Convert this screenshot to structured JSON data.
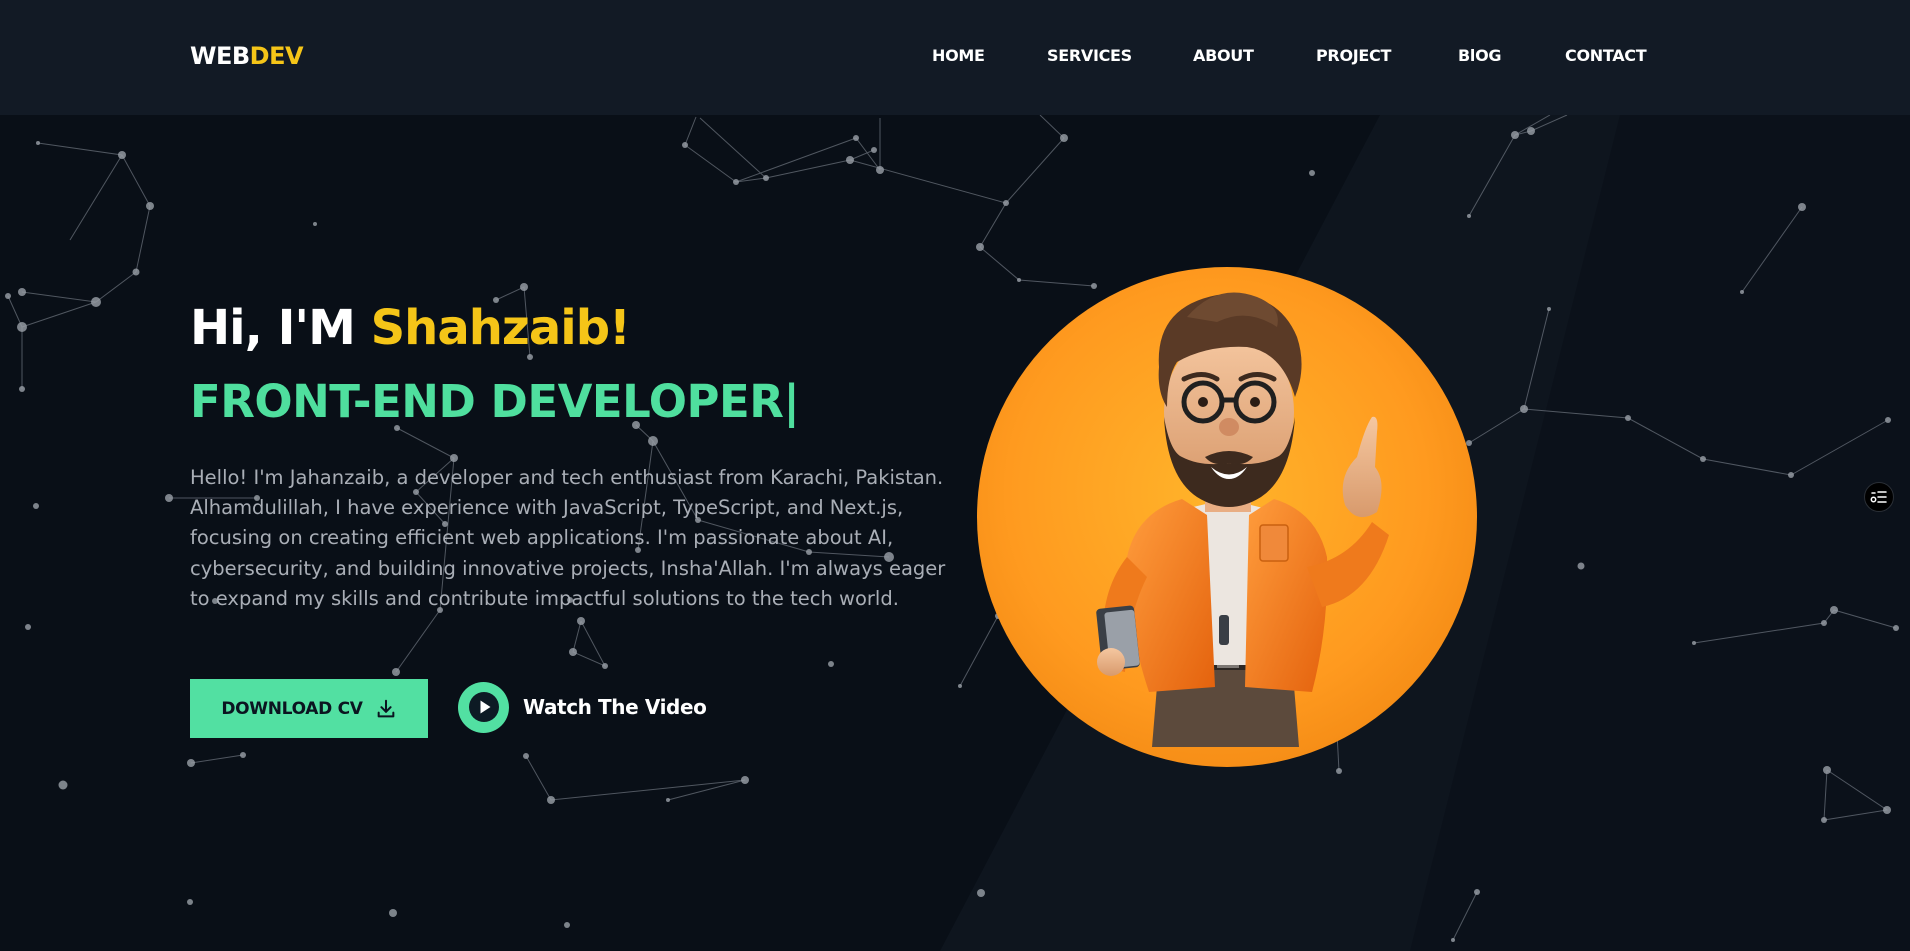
{
  "header": {
    "logo_part1": "WEB",
    "logo_part2": "DEV",
    "nav": [
      "HOME",
      "SERVICES",
      "ABOUT",
      "PROJECT",
      "BlOG",
      "CONTACT"
    ]
  },
  "hero": {
    "greeting": "Hi, I'M",
    "name": "Shahzaib!",
    "role": "FRONT-END DEVELOPER|",
    "description": "Hello! I'm Jahanzaib, a developer and tech enthusiast from Karachi, Pakistan. Alhamdulillah, I have experience with JavaScript, TypeScript, and Next.js, focusing on creating efficient web applications. I'm passionate about AI, cybersecurity, and building innovative projects, Insha'Allah. I'm always eager to expand my skills and contribute impactful solutions to the tech world.",
    "download_cv_label": "DOWNLOAD CV",
    "download_icon": "download-icon",
    "watch_video_label": "Watch The Video",
    "play_icon": "play-icon",
    "avatar": "cartoon developer avatar"
  },
  "side_widget_icon": "list-settings-icon",
  "colors": {
    "background": "#090f17",
    "header": "#121a25",
    "accent_yellow": "#f5c518",
    "accent_green": "#52e0a2",
    "avatar_orange": "#ff9a1f",
    "body_text": "#a9aeb6"
  }
}
